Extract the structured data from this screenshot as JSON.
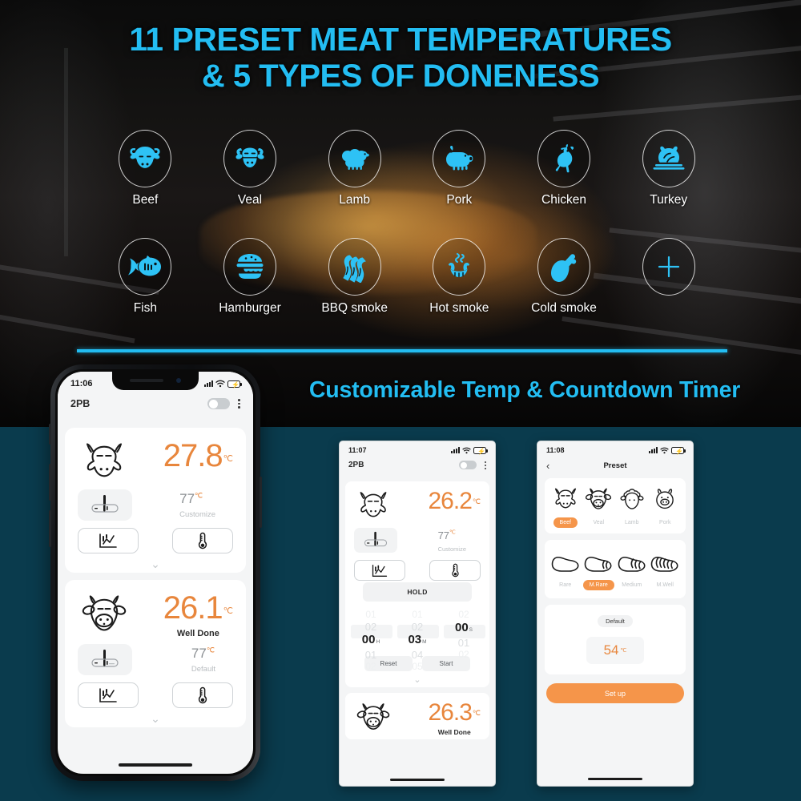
{
  "hero": {
    "headline_line1": "11 PRESET MEAT TEMPERATURES",
    "headline_line2": "& 5 TYPES OF DONENESS",
    "subheadline": "Customizable Temp & Countdown Timer",
    "accent_cyan": "#23bdf2",
    "background_teal": "#0a3b4d",
    "accent_orange": "#e8863c"
  },
  "presets_grid": {
    "row1": [
      {
        "label": "Beef",
        "icon": "cow-head-icon"
      },
      {
        "label": "Veal",
        "icon": "calf-head-icon"
      },
      {
        "label": "Lamb",
        "icon": "sheep-icon"
      },
      {
        "label": "Pork",
        "icon": "pig-icon"
      },
      {
        "label": "Chicken",
        "icon": "chicken-icon"
      },
      {
        "label": "Turkey",
        "icon": "turkey-platter-icon"
      }
    ],
    "row2": [
      {
        "label": "Fish",
        "icon": "fish-icon"
      },
      {
        "label": "Hamburger",
        "icon": "hamburger-icon"
      },
      {
        "label": "BBQ smoke",
        "icon": "bacon-strips-icon"
      },
      {
        "label": "Hot smoke",
        "icon": "hot-sausage-icon"
      },
      {
        "label": "Cold smoke",
        "icon": "drumstick-icon"
      },
      {
        "label": "",
        "icon": "plus-icon"
      }
    ]
  },
  "phone1": {
    "status": {
      "time": "11:06",
      "signal": "signal-bars-icon",
      "wifi": "wifi-icon",
      "battery": "battery-charging-icon"
    },
    "appbar": {
      "title": "2PB",
      "toggle": "power-toggle",
      "menu": "kebab-menu-icon"
    },
    "cards": [
      {
        "meat_icon": "cow-head-icon",
        "temperature": "27.8",
        "unit": "℃",
        "doneness": "",
        "probe_icon": "probe-slider-icon",
        "target_value": "77",
        "target_unit": "℃",
        "target_mode": "Customize",
        "left_button_icon": "chart-icon",
        "right_button_icon": "thermometer-icon",
        "collapse_icon": "chevron-down-icon"
      },
      {
        "meat_icon": "calf-head-icon",
        "temperature": "26.1",
        "unit": "℃",
        "doneness": "Well Done",
        "probe_icon": "probe-slider-icon",
        "target_value": "77",
        "target_unit": "℃",
        "target_mode": "Default",
        "left_button_icon": "chart-icon",
        "right_button_icon": "thermometer-icon",
        "collapse_icon": "chevron-down-icon"
      }
    ]
  },
  "phone2": {
    "status": {
      "time": "11:07",
      "signal": "signal-bars-icon",
      "wifi": "wifi-icon",
      "battery": "battery-charging-icon"
    },
    "appbar": {
      "title": "2PB",
      "toggle": "power-toggle",
      "menu": "kebab-menu-icon"
    },
    "card": {
      "meat_icon": "cow-head-icon",
      "temperature": "26.2",
      "unit": "℃",
      "probe_icon": "probe-slider-icon",
      "target_value": "77",
      "target_unit": "℃",
      "target_mode": "Customize",
      "left_button_icon": "chart-icon",
      "right_button_icon": "thermometer-icon"
    },
    "hold_label": "HOLD",
    "timer": {
      "hours": {
        "above2": "01",
        "above": "02",
        "value": "00",
        "suffix": "H",
        "below": "01",
        "below2": "02"
      },
      "minutes": {
        "above2": "01",
        "above": "02",
        "value": "03",
        "suffix": "M",
        "below": "04",
        "below2": "05"
      },
      "seconds": {
        "above2": "02",
        "above": "",
        "value": "00",
        "suffix": "S",
        "below": "01",
        "below2": "02"
      },
      "reset_label": "Reset",
      "start_label": "Start",
      "collapse_icon": "chevron-down-icon"
    },
    "bottom_card": {
      "meat_icon": "calf-head-icon",
      "temperature": "26.3",
      "unit": "℃",
      "doneness": "Well Done"
    }
  },
  "phone3": {
    "status": {
      "time": "11:08",
      "signal": "signal-bars-icon",
      "wifi": "wifi-icon",
      "battery": "battery-charging-icon"
    },
    "nav": {
      "back_icon": "chevron-left-icon",
      "title": "Preset"
    },
    "meat_options": [
      {
        "label": "Beef",
        "icon": "cow-head-icon",
        "active": true
      },
      {
        "label": "Veal",
        "icon": "calf-head-icon",
        "active": false
      },
      {
        "label": "Lamb",
        "icon": "sheep-icon",
        "active": false
      },
      {
        "label": "Pork",
        "icon": "pig-icon",
        "active": false
      }
    ],
    "doneness_options": [
      {
        "label": "Rare",
        "icon": "steak-rare-icon",
        "active": false
      },
      {
        "label": "M.Rare",
        "icon": "steak-mrare-icon",
        "active": true
      },
      {
        "label": "Medium",
        "icon": "steak-medium-icon",
        "active": false
      },
      {
        "label": "M.Well",
        "icon": "steak-mwell-icon",
        "active": false
      }
    ],
    "default_chip": "Default",
    "temp_value": "54",
    "temp_unit": "℃",
    "setup_label": "Set up"
  }
}
